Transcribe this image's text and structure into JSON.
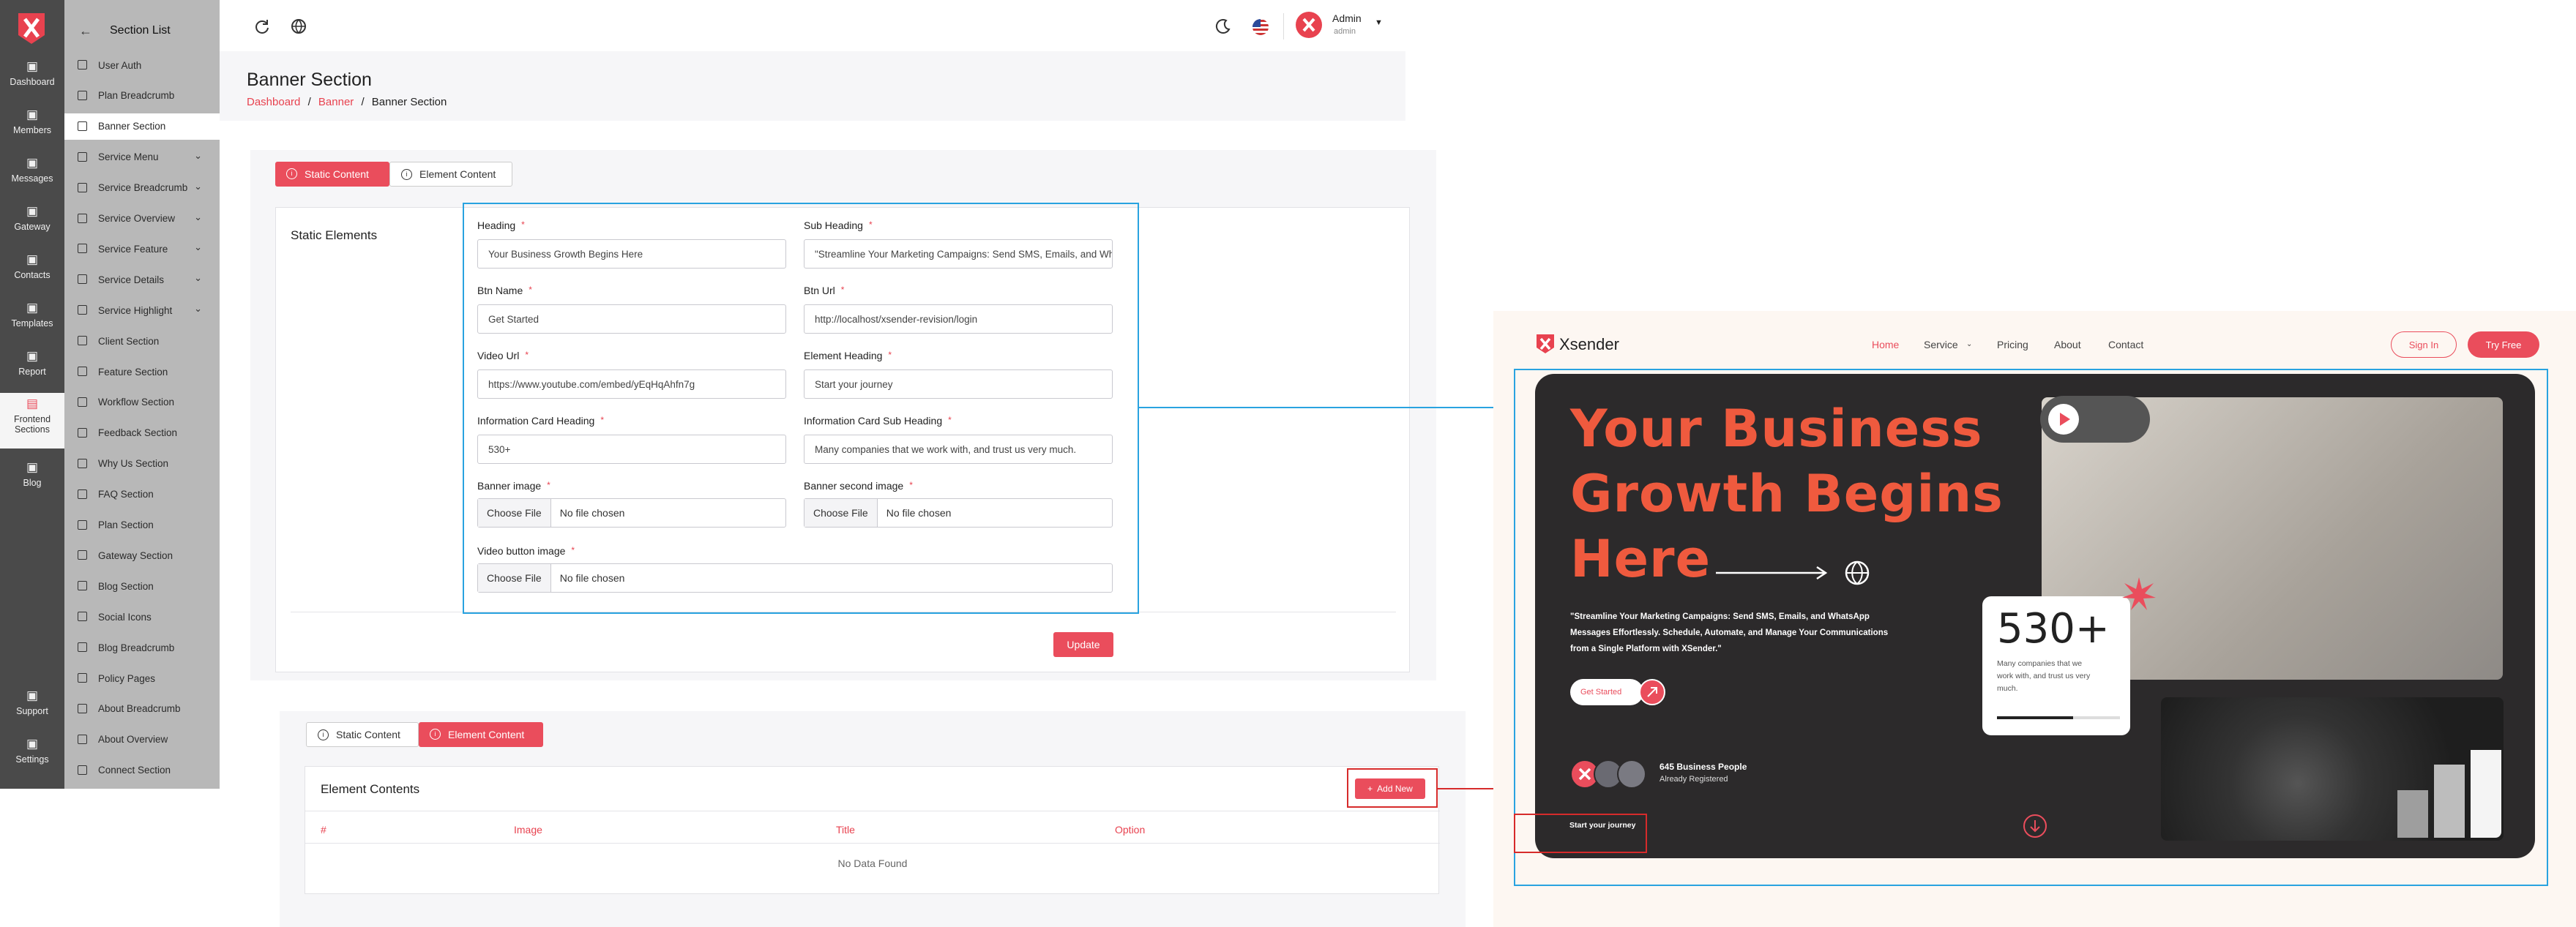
{
  "rail": {
    "items": [
      {
        "label": "Dashboard",
        "icon": "grid-icon"
      },
      {
        "label": "Members",
        "icon": "members-icon"
      },
      {
        "label": "Messages",
        "icon": "mail-icon"
      },
      {
        "label": "Gateway",
        "icon": "gateway-icon"
      },
      {
        "label": "Contacts",
        "icon": "contacts-icon"
      },
      {
        "label": "Templates",
        "icon": "layers-icon"
      },
      {
        "label": "Report",
        "icon": "report-icon"
      },
      {
        "label": "Frontend",
        "label2": "Sections",
        "icon": "frontend-icon"
      },
      {
        "label": "Blog",
        "icon": "blog-icon"
      },
      {
        "label": "Support",
        "icon": "support-icon"
      },
      {
        "label": "Settings",
        "icon": "settings-icon"
      }
    ]
  },
  "section_list": {
    "title": "Section List",
    "items": [
      {
        "label": "User Auth"
      },
      {
        "label": "Plan Breadcrumb"
      },
      {
        "label": "Banner Section",
        "active": true
      },
      {
        "label": "Service Menu",
        "dropdown": true
      },
      {
        "label": "Service Breadcrumb",
        "dropdown": true
      },
      {
        "label": "Service Overview",
        "dropdown": true
      },
      {
        "label": "Service Feature",
        "dropdown": true
      },
      {
        "label": "Service Details",
        "dropdown": true
      },
      {
        "label": "Service Highlight",
        "dropdown": true
      },
      {
        "label": "Client Section"
      },
      {
        "label": "Feature Section"
      },
      {
        "label": "Workflow Section"
      },
      {
        "label": "Feedback Section"
      },
      {
        "label": "Why Us Section"
      },
      {
        "label": "FAQ Section"
      },
      {
        "label": "Plan Section"
      },
      {
        "label": "Gateway Section"
      },
      {
        "label": "Blog Section"
      },
      {
        "label": "Social Icons"
      },
      {
        "label": "Blog Breadcrumb"
      },
      {
        "label": "Policy Pages"
      },
      {
        "label": "About Breadcrumb"
      },
      {
        "label": "About Overview"
      },
      {
        "label": "Connect Section"
      }
    ]
  },
  "topbar": {
    "user_name": "Admin",
    "user_role": "admin"
  },
  "header": {
    "title": "Banner Section",
    "breadcrumb": [
      "Dashboard",
      "Banner",
      "Banner Section"
    ],
    "sep": "/"
  },
  "form": {
    "tabs": [
      "Static Content",
      "Element Content"
    ],
    "card_title": "Static Elements",
    "fields": {
      "heading": {
        "label": "Heading",
        "value": "Your Business Growth Begins Here"
      },
      "sub_heading": {
        "label": "Sub Heading",
        "value": "\"Streamline Your Marketing Campaigns: Send SMS, Emails, and WhatsApp"
      },
      "btn_name": {
        "label": "Btn Name",
        "value": "Get Started"
      },
      "btn_url": {
        "label": "Btn Url",
        "value": "http://localhost/xsender-revision/login"
      },
      "video_url": {
        "label": "Video Url",
        "value": "https://www.youtube.com/embed/yEqHqAhfn7g"
      },
      "element_heading": {
        "label": "Element Heading",
        "value": "Start your journey"
      },
      "info_card_heading": {
        "label": "Information Card Heading",
        "value": "530+"
      },
      "info_card_sub": {
        "label": "Information Card Sub Heading",
        "value": "Many companies that we work with, and trust us very much."
      },
      "banner_image": {
        "label": "Banner image"
      },
      "banner_second_image": {
        "label": "Banner second image"
      },
      "video_button_image": {
        "label": "Video button image"
      }
    },
    "file_button": "Choose File",
    "file_status": "No file chosen",
    "required_mark": "*",
    "update_label": "Update"
  },
  "elements": {
    "tabs": [
      "Static Content",
      "Element Content"
    ],
    "card_title": "Element Contents",
    "add_new": "Add New",
    "columns": [
      "#",
      "Image",
      "Title",
      "Option"
    ],
    "empty": "No Data Found"
  },
  "preview": {
    "brand": "Xsender",
    "nav": [
      "Home",
      "Service",
      "Pricing",
      "About",
      "Contact"
    ],
    "sign_in": "Sign In",
    "try_free": "Try Free",
    "heading_lines": [
      "Your Business",
      "Growth Begins",
      "Here"
    ],
    "sub_lines": [
      "\"Streamline Your Marketing Campaigns: Send SMS, Emails, and WhatsApp",
      "Messages Effortlessly. Schedule, Automate, and Manage Your Communications",
      "from a Single Platform with XSender.\""
    ],
    "cta": "Get Started",
    "stat": "530+",
    "stat_sub": [
      "Many companies that we",
      "work with, and trust us very",
      "much."
    ],
    "people_count": "645 Business People",
    "people_sub": "Already Registered",
    "journey": "Start your journey"
  },
  "colors": {
    "accent": "#ea4d5c",
    "rail_bg": "#4a4a4a",
    "section_bg": "#b8b8b8",
    "annotation": "#29a3e0",
    "hero_bg": "#2c2a2b",
    "hero_text": "#ef5a3e"
  }
}
